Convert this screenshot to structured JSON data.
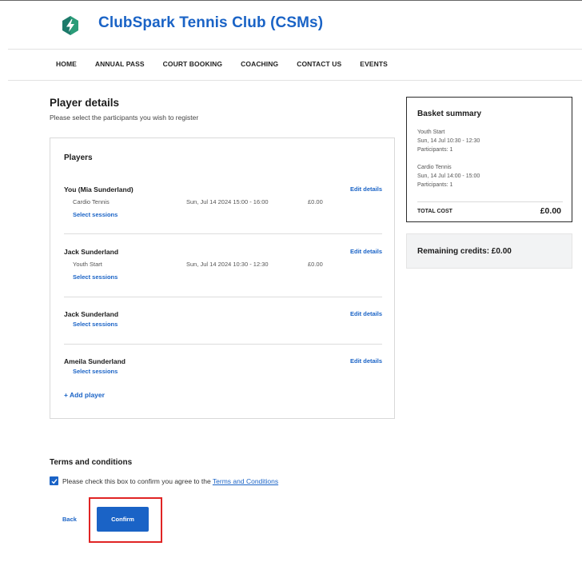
{
  "header": {
    "club_title": "ClubSpark Tennis Club (CSMs)",
    "logo_icon": "clubspark-lightning-logo-icon",
    "brand_color": "#1a63c6"
  },
  "nav": {
    "items": [
      "HOME",
      "ANNUAL PASS",
      "COURT BOOKING",
      "COACHING",
      "CONTACT US",
      "EVENTS"
    ]
  },
  "player_details": {
    "title": "Player details",
    "subtitle": "Please select the participants you wish to register",
    "players_heading": "Players",
    "edit_label": "Edit details",
    "select_sessions_label": "Select sessions",
    "add_player_label": "+ Add player",
    "players": [
      {
        "name": "You (Mia Sunderland)",
        "session": {
          "name": "Cardio Tennis",
          "date": "Sun, Jul 14 2024 15:00 - 16:00",
          "price": "£0.00"
        }
      },
      {
        "name": "Jack Sunderland",
        "session": {
          "name": "Youth Start",
          "date": "Sun, Jul 14 2024 10:30 - 12:30",
          "price": "£0.00"
        }
      },
      {
        "name": "Jack Sunderland"
      },
      {
        "name": "Ameila Sunderland"
      }
    ]
  },
  "basket": {
    "title": "Basket summary",
    "items": [
      {
        "name": "Youth Start",
        "when": "Sun, 14 Jul 10:30 - 12:30",
        "participants": "Participants: 1"
      },
      {
        "name": "Cardio Tennis",
        "when": "Sun, 14 Jul 14:00 - 15:00",
        "participants": "Participants: 1"
      }
    ],
    "total_label": "TOTAL COST",
    "total_value": "£0.00"
  },
  "credits": {
    "text": "Remaining credits: £0.00"
  },
  "terms": {
    "title": "Terms and conditions",
    "checked": true,
    "text": "Please check this box to confirm you agree to the ",
    "link": "Terms and Conditions"
  },
  "actions": {
    "back_label": "Back",
    "confirm_label": "Confirm",
    "highlight_color": "#e02424"
  }
}
